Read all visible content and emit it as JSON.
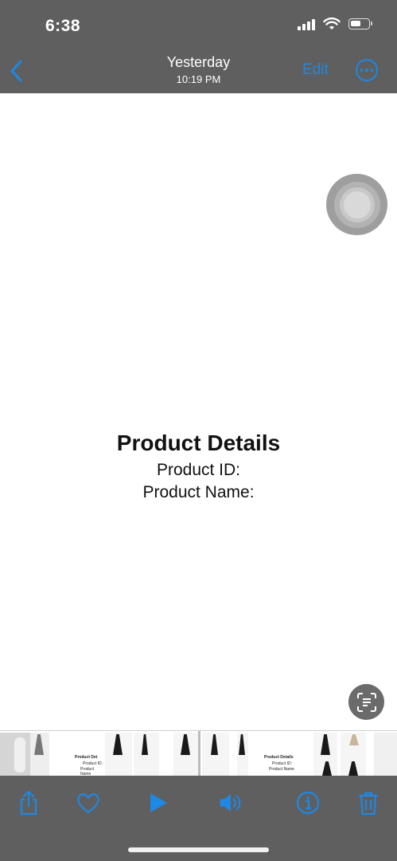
{
  "status_bar": {
    "time": "6:38"
  },
  "nav": {
    "title": "Yesterday",
    "subtitle": "10:19 PM",
    "edit_label": "Edit"
  },
  "document": {
    "heading": "Product Details",
    "product_id_label": "Product ID:",
    "product_name_label": "Product Name:"
  },
  "filmstrip": {
    "thumb_heading": "Product Det",
    "thumb_heading_full": "Product Details",
    "thumb_line1": "Product ID:",
    "thumb_line2": "Product Name"
  },
  "toolbar": {
    "icons": [
      "share-icon",
      "favorite-heart-icon",
      "play-icon",
      "volume-icon",
      "info-icon",
      "trash-icon"
    ]
  },
  "colors": {
    "accent": "#1e88e5",
    "bars": "#5f5f5f"
  }
}
